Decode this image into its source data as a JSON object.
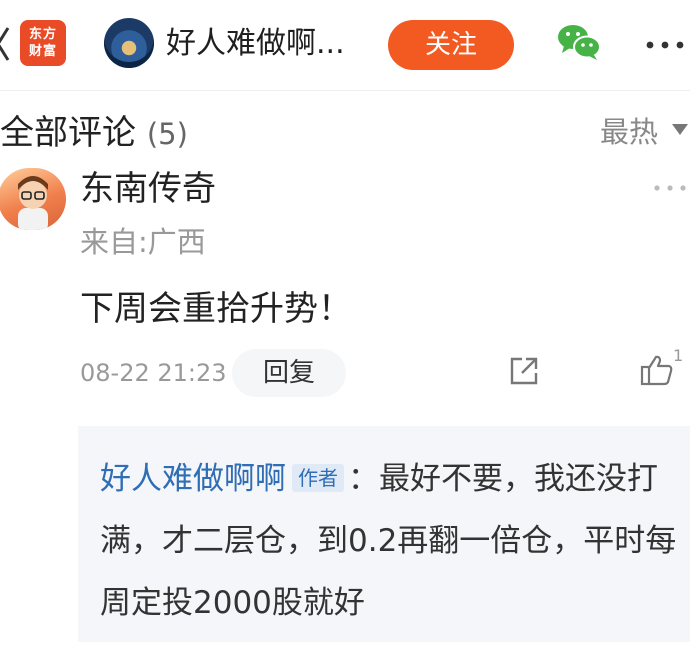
{
  "header": {
    "app_logo_line1": "东方",
    "app_logo_line2": "财富",
    "title": "好人难做啊...",
    "follow_label": "关注"
  },
  "comments_section": {
    "title": "全部评论",
    "count": "(5)",
    "sort_label": "最热"
  },
  "comment": {
    "author": "东南传奇",
    "location": "来自:广西",
    "text": "下周会重拾升势！",
    "time": "08-22 21:23",
    "reply_label": "回复",
    "like_count": "1"
  },
  "author_reply": {
    "author": "好人难做啊啊",
    "badge": "作者",
    "separator": "：",
    "text": "最好不要，我还没打满，才二层仓，到0.2再翻一倍仓，平时每周定投2000股就好"
  },
  "colors": {
    "accent": "#f25a22",
    "link_blue": "#2f6db5",
    "wechat_green": "#47b347"
  }
}
